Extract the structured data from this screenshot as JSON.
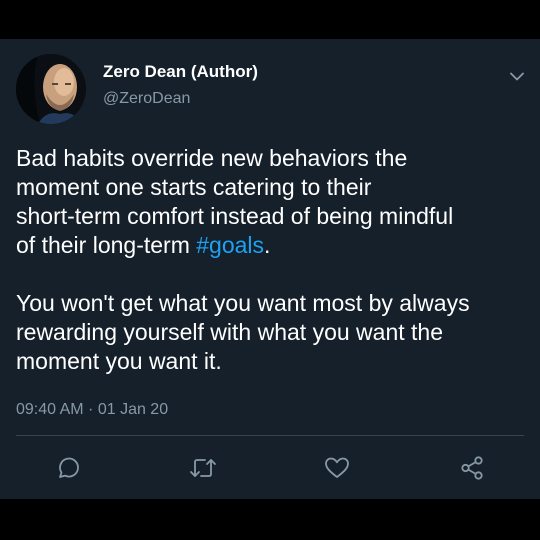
{
  "tweet": {
    "author": {
      "display_name": "Zero Dean (Author)",
      "handle": "@ZeroDean",
      "avatar_icon": "author-avatar"
    },
    "body": {
      "paragraph1": {
        "line1": "Bad habits override new behaviors the",
        "line2": "moment one starts catering to their",
        "line3": "short-term comfort instead of being mindful",
        "line4_prefix": "of their long-term ",
        "hashtag": "#goals",
        "line4_suffix": "."
      },
      "paragraph2": {
        "line1": "You won't get what you want most by always",
        "line2": "rewarding yourself with what you want the",
        "line3": "moment you want it."
      }
    },
    "timestamp": "09:40 AM · 01 Jan 20",
    "actions": [
      "reply-icon",
      "retweet-icon",
      "like-icon",
      "share-icon"
    ]
  },
  "colors": {
    "background": "#15202b",
    "text": "#ffffff",
    "secondary_text": "#8899a6",
    "accent": "#1da1f2",
    "divider": "#38444d"
  }
}
